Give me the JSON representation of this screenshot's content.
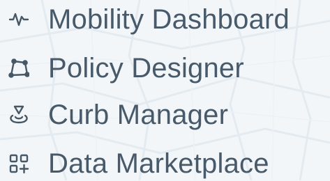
{
  "nav": {
    "items": [
      {
        "label": "Mobility Dashboard",
        "icon": "activity-pulse-icon"
      },
      {
        "label": "Policy Designer",
        "icon": "polygon-vertices-icon"
      },
      {
        "label": "Curb Manager",
        "icon": "map-pin-location-icon"
      },
      {
        "label": "Data Marketplace",
        "icon": "grid-plus-icon"
      }
    ]
  },
  "colors": {
    "text": "#485a6a",
    "icon": "#465766",
    "background": "#f2f6f9"
  }
}
